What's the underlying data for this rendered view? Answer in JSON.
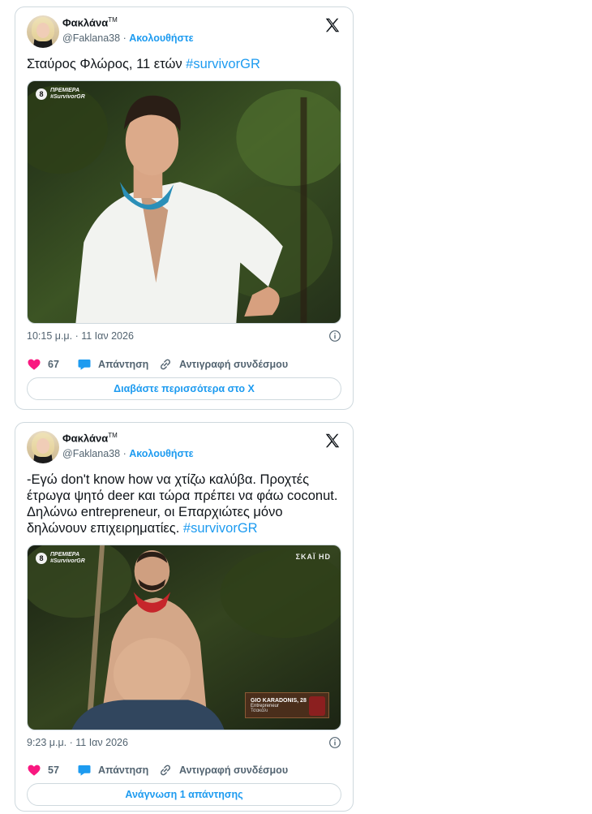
{
  "tweets": [
    {
      "author_name": "Φακλάνα",
      "author_tm": "TM",
      "handle": "@Faklana38",
      "separator": "·",
      "follow_label": "Ακολουθήστε",
      "text": "Σταύρος Φλώρος, 11 ετών",
      "hashtag": "#survivorGR",
      "media": {
        "badge_icon": "8",
        "badge_line1": "ΠΡΕΜΙΕΡΑ",
        "badge_line2": "#SurvivorGR"
      },
      "timestamp": "10:15 μ.μ. · 11 Ιαν 2026",
      "likes": "67",
      "reply_label": "Απάντηση",
      "copy_label": "Αντιγραφή συνδέσμου",
      "cta_label": "Διαβάστε περισσότερα στο X"
    },
    {
      "author_name": "Φακλάνα",
      "author_tm": "TM",
      "handle": "@Faklana38",
      "separator": "·",
      "follow_label": "Ακολουθήστε",
      "text": "-Εγώ don't know how να χτίζω καλύβα. Προχτές έτρωγα ψητό deer και τώρα πρέπει να φάω coconut. Δηλώνω entrepreneur, οι Επαρχιώτες μόνο δηλώνουν επιχειρηματίες.",
      "hashtag": "#survivorGR",
      "media": {
        "badge_icon": "8",
        "badge_line1": "ΠΡΕΜΙΕΡΑ",
        "badge_line2": "#SurvivorGR",
        "channel_logo": "ΣΚΑΪ HD",
        "lower_third_name": "GIO KARADONIS, 28",
        "lower_third_role": "Entrepreneur",
        "lower_third_team": "Τσακάλι"
      },
      "timestamp": "9:23 μ.μ. · 11 Ιαν 2026",
      "likes": "57",
      "reply_label": "Απάντηση",
      "copy_label": "Αντιγραφή συνδέσμου",
      "cta_label": "Ανάγνωση 1 απάντησης"
    }
  ],
  "colors": {
    "accent": "#1d9bf0",
    "like": "#f91880",
    "muted": "#536471",
    "border": "#cfd9de"
  }
}
